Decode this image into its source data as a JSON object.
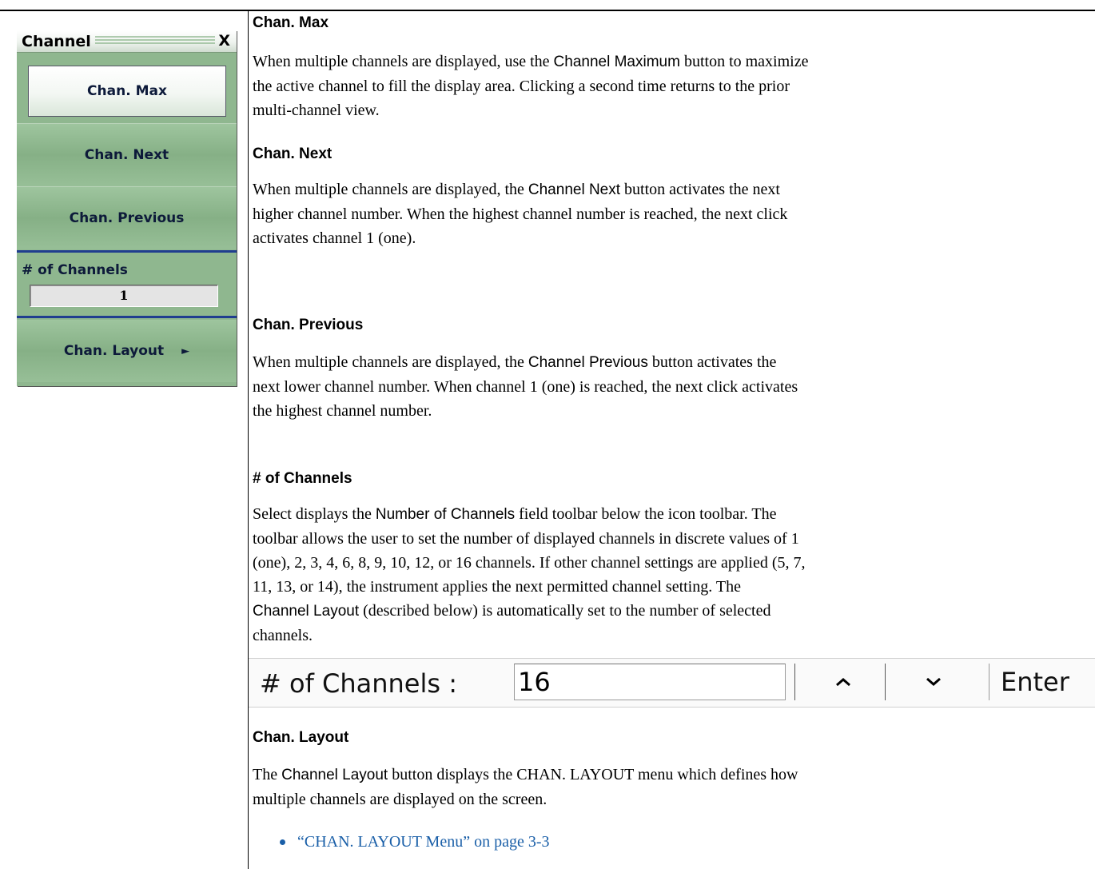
{
  "menu": {
    "title": "Channel",
    "close_label": "X",
    "buttons": {
      "max": "Chan. Max",
      "next": "Chan. Next",
      "previous": "Chan. Previous",
      "layout": "Chan. Layout"
    },
    "layout_arrow": "►",
    "num_channels_label": "# of Channels",
    "num_channels_value": "1"
  },
  "doc": {
    "max": {
      "heading": "Chan. Max",
      "line1a": "When multiple channels are displayed, use the ",
      "line1_ui": "Channel Maximum",
      "line1b": " button to maximize",
      "line2": "the active channel to fill the display area. Clicking a second time returns to the prior",
      "line3": "multi-channel view."
    },
    "next": {
      "heading": "Chan. Next",
      "line1a": "When multiple channels are displayed, the ",
      "line1_ui": "Channel Next",
      "line1b": " button activates the next",
      "line2": "higher channel number. When the highest channel number is reached, the next click",
      "line3": "activates channel 1 (one)."
    },
    "previous": {
      "heading": "Chan. Previous",
      "line1a": "When multiple channels are displayed, the ",
      "line1_ui": "Channel Previous",
      "line1b": " button activates the",
      "line2": "next lower channel number. When channel 1 (one) is reached, the next click activates",
      "line3": "the highest channel number."
    },
    "num": {
      "heading": "# of Channels",
      "line1a": "Select displays the ",
      "line1_ui": "Number of Channels",
      "line1b": " field toolbar below the icon toolbar. The",
      "line2": "toolbar allows the user to set the number of displayed channels in discrete values of 1",
      "line3": "(one), 2, 3, 4, 6, 8, 9, 10, 12, or 16 channels. If other channel settings are applied (5, 7,",
      "line4": "11, 13, or 14), the instrument applies the next permitted channel setting. The",
      "line5_ui": "Channel Layout",
      "line5b": " (described below) is automatically set to the number of selected",
      "line6": "channels."
    },
    "layout": {
      "heading": "Chan. Layout",
      "line1a": "The ",
      "line1_ui": "Channel Layout",
      "line1b": " button displays the CHAN. LAYOUT menu which defines how",
      "line2": "multiple channels are displayed on the screen.",
      "link": "“CHAN. LAYOUT Menu” on page 3-3"
    }
  },
  "toolbar": {
    "label": "# of Channels  :",
    "value": "16",
    "up_icon": "chevron-up-icon",
    "down_icon": "chevron-down-icon",
    "enter_label": "Enter"
  },
  "colors": {
    "menu_green": "#8fb78f",
    "menu_text": "#0d1a3a",
    "separator_blue": "#1f3d8f",
    "link_blue": "#1a5fa8"
  }
}
